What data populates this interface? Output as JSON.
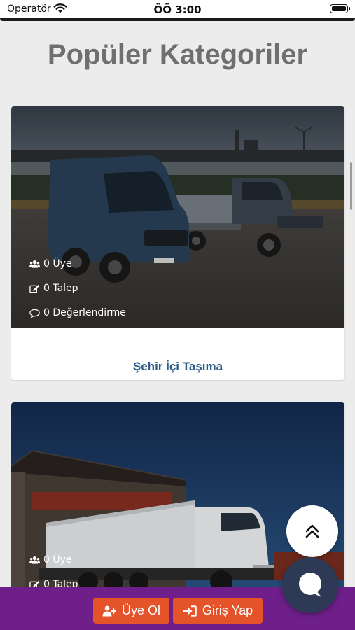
{
  "status_bar": {
    "carrier": "Operatör",
    "time": "ÖÖ 3:00"
  },
  "page": {
    "title": "Popüler Kategoriler"
  },
  "categories": [
    {
      "title": "Şehir İçi Taşıma",
      "stats": {
        "members": "0 Üye",
        "requests": "0 Talep",
        "reviews": "0 Değerlendirme"
      },
      "image": "vans-on-lot"
    },
    {
      "title": "",
      "stats": {
        "members": "0 Üye",
        "requests": "0 Talep"
      },
      "image": "truck-at-warehouse"
    }
  ],
  "actions": {
    "signup_label": "Üye Ol",
    "login_label": "Giriş Yap",
    "scroll_top_icon": "double-chevron-up-icon",
    "chat_icon": "chat-bubble-icon"
  },
  "colors": {
    "bottom_bar": "#6e1f8a",
    "action_button": "#e4532a",
    "category_title": "#2f5d8a",
    "chat_fab": "#2e3a55"
  }
}
